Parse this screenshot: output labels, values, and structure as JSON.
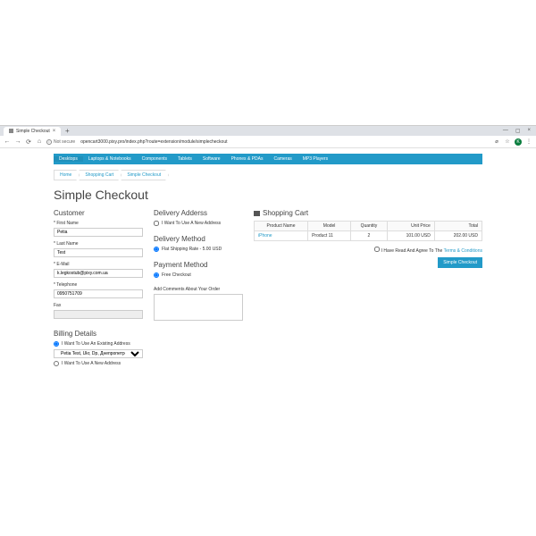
{
  "browser": {
    "tab_title": "Simple Checkout",
    "not_secure": "Not secure",
    "url": "opencart3000.pixy.pro/index.php?route=extension/module/simplecheckout",
    "avatar_letter": "K"
  },
  "menu": {
    "items": [
      "Desktops",
      "Laptops & Notebooks",
      "Components",
      "Tablets",
      "Software",
      "Phones & PDAs",
      "Cameras",
      "MP3 Players"
    ]
  },
  "crumbs": {
    "home": "Home",
    "cart": "Shopping Cart",
    "checkout": "Simple Checkout"
  },
  "title": "Simple Checkout",
  "customer": {
    "heading": "Customer",
    "first_label": "* First Name",
    "first_val": "Petia",
    "last_label": "* Last Name",
    "last_val": "Test",
    "email_label": "* E-Mail",
    "email_val": "k.legkostub@pixy.com.ua",
    "tel_label": "* Telephone",
    "tel_val": "0950751709",
    "fax_label": "Fax",
    "fax_val": ""
  },
  "billing": {
    "heading": "Billing Details",
    "existing_label": "I Want To Use An Existing Address",
    "select_val": "Petia Test, Ukr, Dp, Днепропетровск",
    "new_label": "I Want To Use A New Address"
  },
  "delivery_addr": {
    "heading": "Delivery Adderss",
    "new_label": "I Want To Use A New Address"
  },
  "delivery_method": {
    "heading": "Delivery Method",
    "option": "Flat Shipping Rate - 5.00 USD"
  },
  "payment_method": {
    "heading": "Payment Method",
    "option": "Free Checkout"
  },
  "comments": {
    "label": "Add Comments About Your Order"
  },
  "cart": {
    "heading": "Shopping Cart",
    "cols": {
      "name": "Product Name",
      "model": "Model",
      "qty": "Quantity",
      "unit": "Unit Price",
      "total": "Total"
    },
    "row": {
      "name": "iPhone",
      "model": "Product 11",
      "qty": "2",
      "unit": "101.00 USD",
      "total": "202.00 USD"
    }
  },
  "terms": {
    "prefix": "I Have Read And Agree To The ",
    "link": "Terms & Conditions"
  },
  "button": "Simple Checkout"
}
